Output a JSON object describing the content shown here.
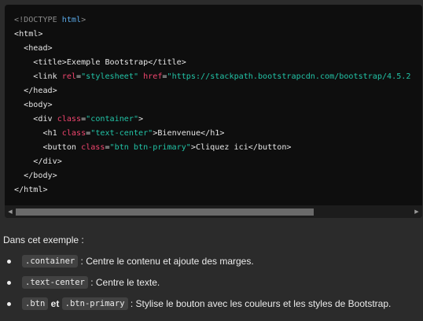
{
  "code": {
    "lines": [
      [
        {
          "c": "com",
          "t": "<!DOCTYPE "
        },
        {
          "c": "kw",
          "t": "html"
        },
        {
          "c": "com",
          "t": ">"
        }
      ],
      [
        {
          "c": "tag",
          "t": "<html>"
        }
      ],
      [
        {
          "c": "tag",
          "t": "  <head>"
        }
      ],
      [
        {
          "c": "tag",
          "t": "    <title>"
        },
        {
          "c": "text",
          "t": "Exemple Bootstrap"
        },
        {
          "c": "tag",
          "t": "</title>"
        }
      ],
      [
        {
          "c": "tag",
          "t": "    <link "
        },
        {
          "c": "attr",
          "t": "rel"
        },
        {
          "c": "tag",
          "t": "="
        },
        {
          "c": "str",
          "t": "\"stylesheet\""
        },
        {
          "c": "tag",
          "t": " "
        },
        {
          "c": "attr",
          "t": "href"
        },
        {
          "c": "tag",
          "t": "="
        },
        {
          "c": "str",
          "t": "\"https://stackpath.bootstrapcdn.com/bootstrap/4.5.2"
        }
      ],
      [
        {
          "c": "tag",
          "t": "  </head>"
        }
      ],
      [
        {
          "c": "tag",
          "t": "  <body>"
        }
      ],
      [
        {
          "c": "tag",
          "t": "    <div "
        },
        {
          "c": "attr",
          "t": "class"
        },
        {
          "c": "tag",
          "t": "="
        },
        {
          "c": "str",
          "t": "\"container\""
        },
        {
          "c": "tag",
          "t": ">"
        }
      ],
      [
        {
          "c": "tag",
          "t": "      <h1 "
        },
        {
          "c": "attr",
          "t": "class"
        },
        {
          "c": "tag",
          "t": "="
        },
        {
          "c": "str",
          "t": "\"text-center\""
        },
        {
          "c": "tag",
          "t": ">"
        },
        {
          "c": "text",
          "t": "Bienvenue"
        },
        {
          "c": "tag",
          "t": "</h1>"
        }
      ],
      [
        {
          "c": "tag",
          "t": "      <button "
        },
        {
          "c": "attr",
          "t": "class"
        },
        {
          "c": "tag",
          "t": "="
        },
        {
          "c": "str",
          "t": "\"btn btn-primary\""
        },
        {
          "c": "tag",
          "t": ">"
        },
        {
          "c": "text",
          "t": "Cliquez ici"
        },
        {
          "c": "tag",
          "t": "</button>"
        }
      ],
      [
        {
          "c": "tag",
          "t": "    </div>"
        }
      ],
      [
        {
          "c": "tag",
          "t": "  </body>"
        }
      ],
      [
        {
          "c": "tag",
          "t": "</html>"
        }
      ]
    ],
    "scrollbar": {
      "left_arrow": "◀",
      "right_arrow": "▶",
      "thumb_fraction": 0.75
    }
  },
  "explanation": {
    "intro": "Dans cet exemple :",
    "items": [
      {
        "parts": [
          {
            "type": "code",
            "text": ".container"
          },
          {
            "type": "text",
            "text": " : Centre le contenu et ajoute des marges."
          }
        ]
      },
      {
        "parts": [
          {
            "type": "code",
            "text": ".text-center"
          },
          {
            "type": "text",
            "text": " : Centre le texte."
          }
        ]
      },
      {
        "parts": [
          {
            "type": "code",
            "text": ".btn"
          },
          {
            "type": "text",
            "text": " "
          },
          {
            "type": "strong",
            "text": "et"
          },
          {
            "type": "text",
            "text": " "
          },
          {
            "type": "code",
            "text": ".btn-primary"
          },
          {
            "type": "text",
            "text": " : Stylise le bouton avec les couleurs et les styles de Bootstrap."
          }
        ]
      }
    ]
  }
}
